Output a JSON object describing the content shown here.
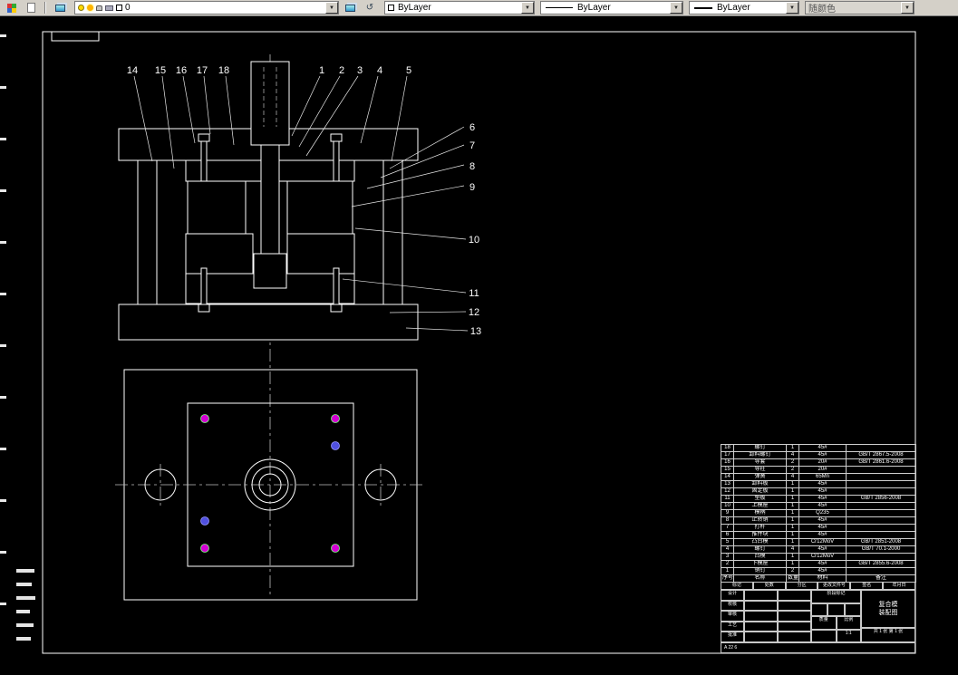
{
  "colors": {
    "canvas_bg": "#000000",
    "line": "#ffffff",
    "toolbar_bg": "#d4d0c8",
    "screw_marker_magenta": "#d400d4",
    "screw_marker_violet": "#5050e0",
    "disabled_text": "#555555"
  },
  "toolbar": {
    "layer_value": "0",
    "color_value": "ByLayer",
    "linetype_value": "ByLayer",
    "lineweight_value": "ByLayer",
    "plot_style_value": "随颜色",
    "dropdown_arrow": "▼"
  },
  "drawing": {
    "callout_numbers": [
      "14",
      "15",
      "16",
      "17",
      "18",
      "1",
      "2",
      "3",
      "4",
      "5",
      "6",
      "7",
      "8",
      "9",
      "10",
      "11",
      "12",
      "13"
    ]
  },
  "parts_table": {
    "headers": [
      "序号",
      "名称",
      "数量",
      "材料",
      "备注"
    ],
    "rows": [
      [
        "18",
        "螺钉",
        "1",
        "45#",
        ""
      ],
      [
        "17",
        "卸料螺钉",
        "4",
        "45#",
        "GB/T 2867.5-2008"
      ],
      [
        "16",
        "导套",
        "2",
        "20#",
        "GB/T 2861.6-2008"
      ],
      [
        "15",
        "导柱",
        "2",
        "20#",
        ""
      ],
      [
        "14",
        "弹簧",
        "4",
        "65Mn",
        ""
      ],
      [
        "13",
        "卸料板",
        "1",
        "45#",
        ""
      ],
      [
        "12",
        "固定板",
        "1",
        "45#",
        ""
      ],
      [
        "11",
        "垫板",
        "1",
        "45#",
        "GB/T 2856-2008"
      ],
      [
        "10",
        "上模座",
        "1",
        "45#",
        ""
      ],
      [
        "9",
        "模柄",
        "1",
        "Q235",
        ""
      ],
      [
        "8",
        "止转销",
        "1",
        "45#",
        ""
      ],
      [
        "7",
        "打杆",
        "1",
        "45#",
        ""
      ],
      [
        "6",
        "推件块",
        "1",
        "45#",
        ""
      ],
      [
        "5",
        "凸凹模",
        "1",
        "Cr12MoV",
        "GB/T 2851-2008"
      ],
      [
        "4",
        "螺钉",
        "4",
        "45#",
        "GB/T 70.1-2000"
      ],
      [
        "3",
        "凹模",
        "1",
        "Cr12MoV",
        ""
      ],
      [
        "2",
        "下模座",
        "1",
        "45#",
        "GB/T 2855.6-2008"
      ],
      [
        "1",
        "销钉",
        "2",
        "45#",
        ""
      ]
    ]
  },
  "title_block": {
    "revision_headers": [
      "标记",
      "处数",
      "分区",
      "更改文件号",
      "签名",
      "年月日"
    ],
    "sign_labels": [
      "设计",
      "校核",
      "审核",
      "工艺",
      "批准"
    ],
    "stage_label": "阶段标记",
    "mass_label": "质量",
    "scale_label": "比例",
    "scale_value": "1:1",
    "title_line1": "复合模",
    "title_line2": "装配图",
    "sheet_info": "共 1 张 第 1 张",
    "footer_note": "A 22 6"
  }
}
